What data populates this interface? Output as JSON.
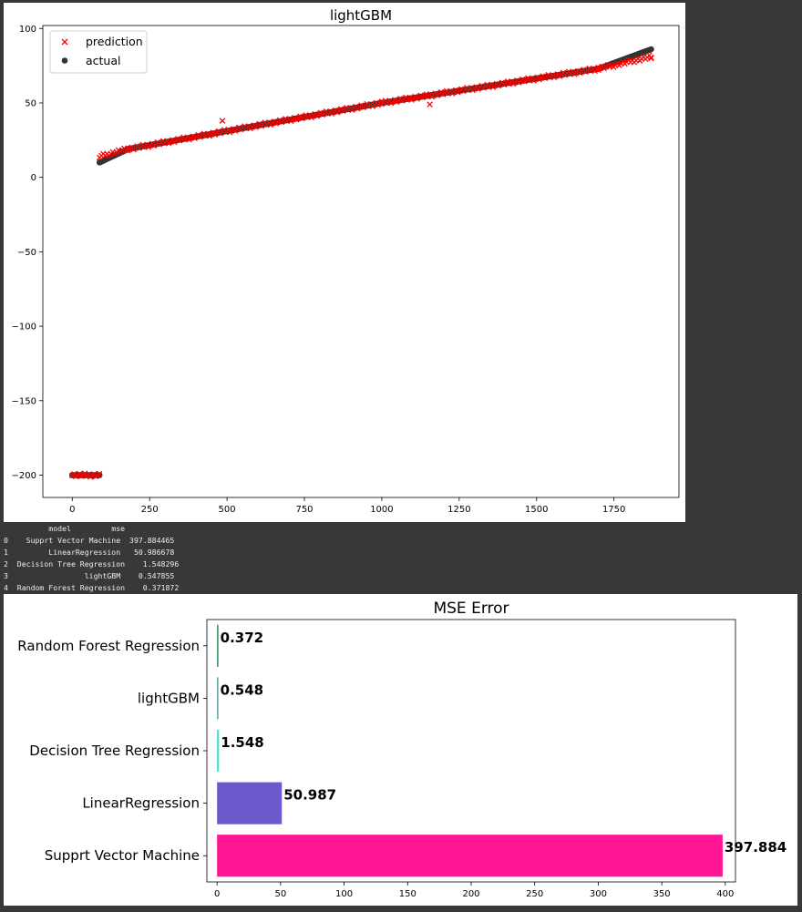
{
  "chart_data": [
    {
      "type": "scatter",
      "title": "lightGBM",
      "xlabel": "",
      "ylabel": "",
      "xlim": [
        -95,
        1960
      ],
      "ylim": [
        -215,
        102
      ],
      "xticks": [
        0,
        250,
        500,
        750,
        1000,
        1250,
        1500,
        1750
      ],
      "yticks": [
        100,
        50,
        0,
        -50,
        -100,
        -150,
        -200
      ],
      "legend_position": "top-left",
      "grid": false,
      "series": [
        {
          "name": "prediction",
          "marker": "x",
          "color": "#ff0000",
          "segments": [
            {
              "x_start": 0,
              "x_end": 88,
              "y_start": -200,
              "y_end": -200
            },
            {
              "x_start": 88,
              "x_end": 180,
              "y_start": 14,
              "y_end": 19
            },
            {
              "x_start": 180,
              "x_end": 1000,
              "y_start": 19,
              "y_end": 50
            },
            {
              "x_start": 1000,
              "x_end": 1700,
              "y_start": 50,
              "y_end": 73
            },
            {
              "x_start": 1700,
              "x_end": 1870,
              "y_start": 73,
              "y_end": 81
            }
          ],
          "outliers": [
            {
              "x": 485,
              "y": 38
            },
            {
              "x": 505,
              "y": 32
            },
            {
              "x": 1155,
              "y": 49
            },
            {
              "x": 1870,
              "y": 80
            }
          ]
        },
        {
          "name": "actual",
          "marker": "o",
          "color": "#333333",
          "segments": [
            {
              "x_start": 0,
              "x_end": 88,
              "y_start": -200,
              "y_end": -200
            },
            {
              "x_start": 88,
              "x_end": 180,
              "y_start": 10,
              "y_end": 19
            },
            {
              "x_start": 180,
              "x_end": 1000,
              "y_start": 19,
              "y_end": 50
            },
            {
              "x_start": 1000,
              "x_end": 1700,
              "y_start": 50,
              "y_end": 73
            },
            {
              "x_start": 1700,
              "x_end": 1870,
              "y_start": 73,
              "y_end": 86
            }
          ]
        }
      ]
    },
    {
      "type": "bar",
      "orientation": "horizontal",
      "title": "MSE Error",
      "xlabel": "",
      "ylabel": "",
      "xlim": [
        -8,
        408
      ],
      "xticks": [
        0,
        50,
        100,
        150,
        200,
        250,
        300,
        350,
        400
      ],
      "categories": [
        "Random Forest Regression",
        "lightGBM",
        "Decision Tree Regression",
        "LinearRegression",
        "Supprt Vector Machine"
      ],
      "values": [
        0.372,
        0.548,
        1.548,
        50.987,
        397.884
      ],
      "data_labels": [
        "0.372",
        "0.548",
        "1.548",
        "50.987",
        "397.884"
      ],
      "colors": [
        "#2e8b57",
        "#5f9ea0",
        "#40e0d0",
        "#6a5acd",
        "#ff1493"
      ],
      "grid": false
    }
  ],
  "table": {
    "header": "          model         mse",
    "rows": [
      "0    Supprt Vector Machine  397.884465",
      "1         LinearRegression   50.986678",
      "2  Decision Tree Regression    1.548296",
      "3                 lightGBM    0.547855",
      "4  Random Forest Regression    0.371872"
    ]
  }
}
